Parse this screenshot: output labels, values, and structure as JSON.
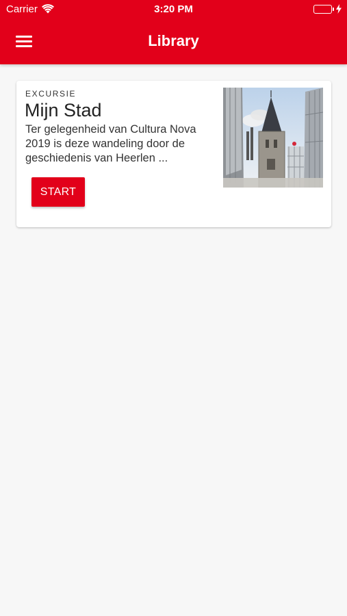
{
  "status_bar": {
    "carrier": "Carrier",
    "time": "3:20 PM",
    "battery_color": "#4cd964"
  },
  "header": {
    "title": "Library",
    "menu_icon": "hamburger-menu-icon",
    "background": "#e2001a"
  },
  "cards": [
    {
      "overline": "EXCURSIE",
      "title": "Mijn Stad",
      "description": "Ter gelegenheid van Cultura Nova 2019 is deze wandeling door de geschiedenis van Heerlen ...",
      "button_label": "START",
      "image": "church-tower-photo"
    }
  ]
}
